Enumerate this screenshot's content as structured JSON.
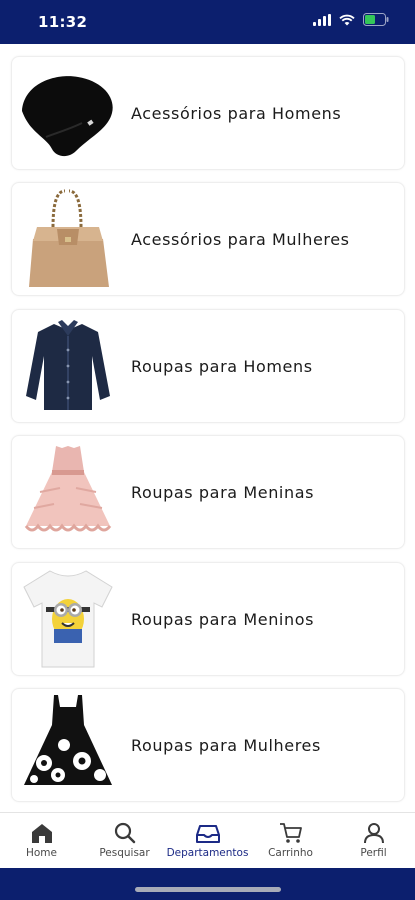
{
  "status_bar": {
    "time": "11:32",
    "background": "#0c1f6e",
    "icons": [
      "signal-icon",
      "wifi-icon",
      "battery-icon"
    ]
  },
  "categories": [
    {
      "label": "Acessórios para Homens",
      "icon": "beanie-hat-image"
    },
    {
      "label": "Acessórios para Mulheres",
      "icon": "handbag-image"
    },
    {
      "label": "Roupas para Homens",
      "icon": "shirt-image"
    },
    {
      "label": "Roupas para Meninas",
      "icon": "girls-dress-image"
    },
    {
      "label": "Roupas para Meninos",
      "icon": "minion-tshirt-image"
    },
    {
      "label": "Roupas para Mulheres",
      "icon": "floral-dress-image"
    }
  ],
  "tab_bar": {
    "active": "Departamentos",
    "active_color": "#1c2a86",
    "tabs": [
      {
        "label": "Home",
        "icon": "home-icon"
      },
      {
        "label": "Pesquisar",
        "icon": "search-icon"
      },
      {
        "label": "Departamentos",
        "icon": "inbox-icon"
      },
      {
        "label": "Carrinho",
        "icon": "cart-icon"
      },
      {
        "label": "Perfil",
        "icon": "profile-icon"
      }
    ]
  }
}
